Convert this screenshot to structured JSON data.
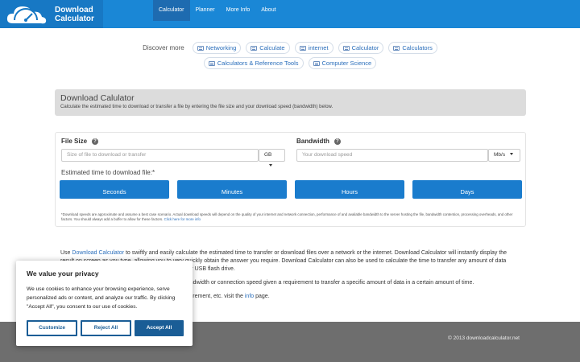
{
  "brand": {
    "line1": "Download",
    "line2": "Calculator"
  },
  "nav": [
    "Calculator",
    "Planner",
    "More Info",
    "About"
  ],
  "discover": {
    "label": "Discover more",
    "row1": [
      "Networking",
      "Calculate",
      "internet",
      "Calculator",
      "Calculators"
    ],
    "row2": [
      "Calculators & Reference Tools",
      "Computer Science"
    ]
  },
  "calc": {
    "title": "Download Calulator",
    "subtitle": "Calculate the estimated time to download or transfer a file by entering the file size and your download speed (bandwidth) below.",
    "file_size_label": "File Size",
    "file_size_placeholder": "Size of file to download or transfer",
    "file_size_unit": "GB",
    "bandwidth_label": "Bandwidth",
    "bandwidth_placeholder": "Your download speed",
    "bandwidth_unit": "Mb/s",
    "estimate_label": "Estimated time to download file:*",
    "results": [
      "Seconds",
      "Minutes",
      "Hours",
      "Days"
    ],
    "note": "*Download speeds are approximate and assume a best case scenario. Actual download speeds will depend on the quality of your internet and network connection, performance of and available bandwidth to the server hosting the file, bandwidth contention, processing overheads, and other factors. You should always add a buffer to allow for these factors.",
    "note_link": "Click here for more info"
  },
  "body": {
    "p1_pre": "Use",
    "p1_link": "Download Calculator",
    "p1_post": "to swiftly and easily calculate the estimated time to transfer or download files over a network or the internet. Download Calculator will instantly display the result on screen as you type, allowing you to very quickly obtain the answer you require. Download Calculator can also be used to calculate the time to transfer any amount of data",
    "p1_tail": "k or USB flash drive.",
    "p2": "bandwidth or connection speed given a requirement to transfer a specific amount of data in a certain amount of time.",
    "p3_pre": "asurement, etc. visit the",
    "p3_link": "info",
    "p3_post": "page."
  },
  "footer": {
    "copyright": "© 2013 downloadcalculator.net"
  },
  "cookie": {
    "title": "We value your privacy",
    "text": "We use cookies to enhance your browsing experience, serve personalized ads or content, and analyze our traffic. By clicking \"Accept All\", you consent to our use of cookies.",
    "customize": "Customize",
    "reject": "Reject All",
    "accept": "Accept All"
  },
  "colors": {
    "header": "#1a87d6",
    "primary_button": "#1a7ccd",
    "cookie_button": "#1a5d96",
    "footer": "#6e6e6e"
  }
}
